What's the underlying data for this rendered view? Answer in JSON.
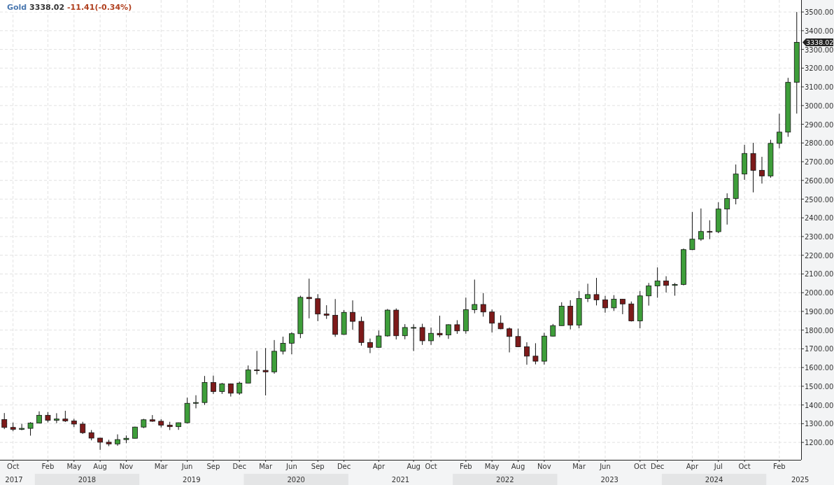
{
  "quote": {
    "symbol": "Gold",
    "price": "3338.02",
    "change": "-11.41(-0.34%)"
  },
  "chart": {
    "last_price_tag": "3338.02",
    "year_labels": [
      "2017",
      "2018",
      "2019",
      "2020",
      "2021",
      "2022",
      "2023",
      "2024",
      "2025"
    ],
    "chart_data": {
      "type": "candlestick",
      "ylim": [
        1107,
        3564
      ],
      "grid": true,
      "categories": [
        null,
        "Oct",
        null,
        null,
        null,
        "Feb",
        null,
        null,
        "May",
        null,
        null,
        "Aug",
        null,
        null,
        "Nov",
        null,
        null,
        null,
        "Mar",
        null,
        null,
        "Jun",
        null,
        null,
        "Sep",
        null,
        null,
        "Dec",
        null,
        null,
        "Mar",
        null,
        null,
        "Jun",
        null,
        null,
        "Sep",
        null,
        null,
        "Dec",
        null,
        null,
        null,
        "Apr",
        null,
        null,
        null,
        "Aug",
        null,
        "Oct",
        null,
        null,
        null,
        "Feb",
        null,
        null,
        "May",
        null,
        null,
        "Aug",
        null,
        null,
        "Nov",
        null,
        null,
        null,
        "Mar",
        null,
        null,
        "Jun",
        null,
        null,
        null,
        "Oct",
        null,
        "Dec",
        null,
        null,
        null,
        "Apr",
        null,
        null,
        "Jul",
        null,
        null,
        "Oct",
        null,
        null,
        null,
        "Feb",
        null,
        null
      ],
      "ohlc": [
        [
          1322,
          1357,
          1271,
          1280
        ],
        [
          1280,
          1306,
          1260,
          1270
        ],
        [
          1270,
          1299,
          1265,
          1275
        ],
        [
          1275,
          1308,
          1236,
          1303
        ],
        [
          1303,
          1366,
          1302,
          1345
        ],
        [
          1345,
          1362,
          1307,
          1318
        ],
        [
          1318,
          1356,
          1303,
          1325
        ],
        [
          1325,
          1369,
          1309,
          1315
        ],
        [
          1315,
          1326,
          1282,
          1298
        ],
        [
          1298,
          1310,
          1245,
          1252
        ],
        [
          1252,
          1266,
          1211,
          1223
        ],
        [
          1223,
          1224,
          1160,
          1201
        ],
        [
          1201,
          1214,
          1180,
          1192
        ],
        [
          1192,
          1243,
          1182,
          1215
        ],
        [
          1215,
          1237,
          1196,
          1222
        ],
        [
          1222,
          1284,
          1221,
          1282
        ],
        [
          1282,
          1326,
          1276,
          1321
        ],
        [
          1321,
          1346,
          1310,
          1313
        ],
        [
          1313,
          1324,
          1280,
          1292
        ],
        [
          1292,
          1310,
          1266,
          1284
        ],
        [
          1284,
          1306,
          1267,
          1305
        ],
        [
          1305,
          1439,
          1301,
          1409
        ],
        [
          1409,
          1452,
          1382,
          1413
        ],
        [
          1413,
          1555,
          1400,
          1520
        ],
        [
          1520,
          1557,
          1459,
          1472
        ],
        [
          1472,
          1518,
          1459,
          1513
        ],
        [
          1513,
          1515,
          1445,
          1463
        ],
        [
          1463,
          1525,
          1454,
          1517
        ],
        [
          1517,
          1611,
          1517,
          1587
        ],
        [
          1587,
          1689,
          1563,
          1585
        ],
        [
          1585,
          1704,
          1451,
          1577
        ],
        [
          1577,
          1747,
          1567,
          1687
        ],
        [
          1687,
          1765,
          1670,
          1730
        ],
        [
          1730,
          1789,
          1671,
          1781
        ],
        [
          1781,
          1984,
          1757,
          1975
        ],
        [
          1975,
          2075,
          1863,
          1968
        ],
        [
          1968,
          1992,
          1848,
          1886
        ],
        [
          1886,
          1933,
          1860,
          1879
        ],
        [
          1879,
          1966,
          1764,
          1777
        ],
        [
          1777,
          1907,
          1775,
          1895
        ],
        [
          1895,
          1959,
          1802,
          1847
        ],
        [
          1847,
          1872,
          1717,
          1734
        ],
        [
          1734,
          1755,
          1677,
          1708
        ],
        [
          1708,
          1798,
          1706,
          1769
        ],
        [
          1769,
          1913,
          1765,
          1907
        ],
        [
          1907,
          1916,
          1750,
          1770
        ],
        [
          1770,
          1832,
          1751,
          1814
        ],
        [
          1814,
          1831,
          1688,
          1814
        ],
        [
          1814,
          1834,
          1721,
          1743
        ],
        [
          1743,
          1814,
          1721,
          1783
        ],
        [
          1783,
          1877,
          1762,
          1774
        ],
        [
          1774,
          1831,
          1753,
          1829
        ],
        [
          1829,
          1853,
          1780,
          1796
        ],
        [
          1796,
          1974,
          1781,
          1909
        ],
        [
          1909,
          2070,
          1890,
          1937
        ],
        [
          1937,
          1998,
          1872,
          1897
        ],
        [
          1897,
          1910,
          1787,
          1837
        ],
        [
          1837,
          1879,
          1805,
          1807
        ],
        [
          1807,
          1814,
          1681,
          1766
        ],
        [
          1766,
          1808,
          1709,
          1711
        ],
        [
          1711,
          1735,
          1615,
          1661
        ],
        [
          1661,
          1730,
          1617,
          1634
        ],
        [
          1634,
          1786,
          1616,
          1768
        ],
        [
          1768,
          1833,
          1766,
          1824
        ],
        [
          1824,
          1949,
          1824,
          1928
        ],
        [
          1928,
          1960,
          1804,
          1827
        ],
        [
          1827,
          2009,
          1810,
          1969
        ],
        [
          1969,
          2048,
          1950,
          1990
        ],
        [
          1990,
          2079,
          1932,
          1962
        ],
        [
          1962,
          1983,
          1893,
          1919
        ],
        [
          1919,
          1987,
          1903,
          1965
        ],
        [
          1965,
          1967,
          1885,
          1940
        ],
        [
          1940,
          1953,
          1846,
          1849
        ],
        [
          1849,
          2009,
          1810,
          1983
        ],
        [
          1983,
          2052,
          1931,
          2036
        ],
        [
          2036,
          2135,
          1973,
          2063
        ],
        [
          2063,
          2088,
          2001,
          2039
        ],
        [
          2039,
          2052,
          1984,
          2044
        ],
        [
          2044,
          2236,
          2039,
          2230
        ],
        [
          2230,
          2431,
          2228,
          2286
        ],
        [
          2286,
          2450,
          2277,
          2327
        ],
        [
          2327,
          2387,
          2286,
          2326
        ],
        [
          2326,
          2483,
          2318,
          2447
        ],
        [
          2447,
          2531,
          2364,
          2503
        ],
        [
          2503,
          2685,
          2472,
          2634
        ],
        [
          2634,
          2790,
          2603,
          2744
        ],
        [
          2744,
          2801,
          2536,
          2654
        ],
        [
          2654,
          2726,
          2583,
          2624
        ],
        [
          2624,
          2817,
          2614,
          2798
        ],
        [
          2798,
          2956,
          2772,
          2858
        ],
        [
          2858,
          3148,
          2833,
          3124
        ],
        [
          3124,
          3500,
          2957,
          3338
        ]
      ],
      "yticks": [
        {
          "value": 1200,
          "label": "1200.00"
        },
        {
          "value": 1300,
          "label": "1300.00"
        },
        {
          "value": 1400,
          "label": "1400.00"
        },
        {
          "value": 1500,
          "label": "1500.00"
        },
        {
          "value": 1600,
          "label": "1600.00"
        },
        {
          "value": 1700,
          "label": "1700.00"
        },
        {
          "value": 1800,
          "label": "1800.00"
        },
        {
          "value": 1900,
          "label": "1900.00"
        },
        {
          "value": 2000,
          "label": "2000.00"
        },
        {
          "value": 2100,
          "label": "2100.00"
        },
        {
          "value": 2200,
          "label": "2200.00"
        },
        {
          "value": 2300,
          "label": "2300.00"
        },
        {
          "value": 2400,
          "label": "2400.00"
        },
        {
          "value": 2500,
          "label": "2500.00"
        },
        {
          "value": 2600,
          "label": "2600.00"
        },
        {
          "value": 2700,
          "label": "2700.00"
        },
        {
          "value": 2800,
          "label": "2800.00"
        },
        {
          "value": 2900,
          "label": "2900.00"
        },
        {
          "value": 3000,
          "label": "3000.00"
        },
        {
          "value": 3100,
          "label": "3100.00"
        },
        {
          "value": 3200,
          "label": "3200.00"
        },
        {
          "value": 3300,
          "label": "3300.00"
        },
        {
          "value": 3400,
          "label": "3400.00"
        },
        {
          "value": 3500,
          "label": "3500.00"
        }
      ]
    }
  }
}
